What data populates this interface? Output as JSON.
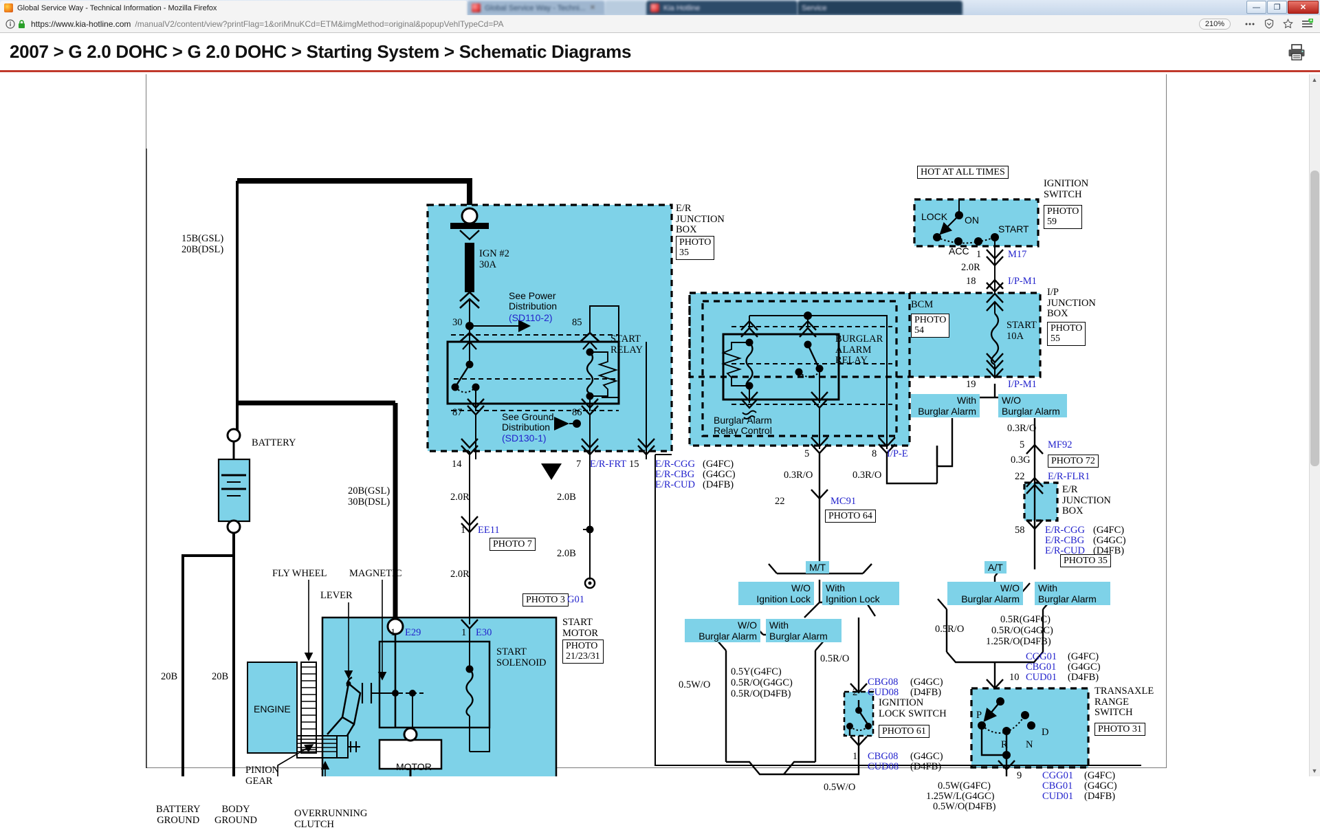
{
  "browser": {
    "window_title": "Global Service Way - Technical Information - Mozilla Firefox",
    "tabs": [
      {
        "label": "Global Service Way - Technical Information - Mozilla Firefox",
        "state": "active"
      },
      {
        "label": "Global Service Way - Techni...",
        "state": "inactive"
      },
      {
        "label": "Kia Hotline",
        "state": "inactive"
      },
      {
        "label": "Service",
        "state": "inactive"
      }
    ],
    "window_controls": {
      "minimize": "—",
      "maximize": "❐",
      "close": "✕"
    },
    "url": {
      "scheme_host": "https://www.kia-hotline.com",
      "path": "/manualV2/content/view?printFlag=1&oriMnuKCd=ETM&imgMethod=original&popupVehlTypeCd=PA",
      "full": "https://www.kia-hotline.com/manualV2/content/view?printFlag=1&oriMnuKCd=ETM&imgMethod=original&popupVehlTypeCd=PA"
    },
    "zoom_level": "210%",
    "toolbar_icons": [
      "info-icon",
      "lock-icon",
      "page-actions-icon",
      "tracking-shield-icon",
      "bookmark-star-icon",
      "hamburger-menu-icon"
    ]
  },
  "page": {
    "title": "2007 > G 2.0 DOHC > G 2.0 DOHC > Starting System > Schematic Diagrams",
    "print_icon": "printer-icon"
  },
  "diagram": {
    "title": "Starting System Schematic Diagram",
    "accent_cyan": "#7ed2e8",
    "accent_blue_text": "#2222cc",
    "labels": {
      "hot_at_all_times": "HOT AT ALL TIMES",
      "ignition_switch": "IGNITION\nSWITCH",
      "photo_59": "PHOTO\n59",
      "ign_pos_lock": "LOCK",
      "ign_pos_acc": "ACC",
      "ign_pos_on": "ON",
      "ign_pos_start": "START",
      "m17": "M17",
      "w_2_0r_a": "2.0R",
      "pin_1_m17": "1",
      "pin_18": "18",
      "ip_m1_top": "I/P-M1",
      "ip_junction_box": "I/P\nJUNCTION\nBOX",
      "photo_55": "PHOTO\n55",
      "start_10a": "START\n10A",
      "pin_19": "19",
      "ip_m1_bottom": "I/P-M1",
      "with_burglar_alarm_1": "With\nBurglar Alarm",
      "wo_burglar_alarm_1": "W/O\nBurglar Alarm",
      "w_0_3ro_a": "0.3R/O",
      "pin_5_mf92": "5",
      "mf92": "MF92",
      "photo_72": "PHOTO 72",
      "w_0_3g": "0.3G",
      "pin_22_flr1": "22",
      "er_flr1": "E/R-FLR1",
      "er_junction_box_right": "E/R\nJUNCTION\nBOX",
      "pin_58": "58",
      "er_cgg_58": "E/R-CGG",
      "er_cbg_58": "E/R-CBG",
      "er_cud_58": "E/R-CUD",
      "g4fc": "(G4FC)",
      "g4gc": "(G4GC)",
      "d4fb": "(D4FB)",
      "photo_35_right": "PHOTO 35",
      "bcm": "BCM",
      "photo_54": "PHOTO\n54",
      "burglar_alarm_relay": "BURGLAR\nALARM\nRELAY",
      "burglar_alarm_relay_control": "Burglar Alarm\nRelay Control",
      "pin_5_ipe": "5",
      "pin_8_ipe": "8",
      "ip_e": "I/P-E",
      "w_0_3ro_b": "0.3R/O",
      "w_0_3ro_c": "0.3R/O",
      "pin_22_mc91": "22",
      "mc91": "MC91",
      "photo_64": "PHOTO 64",
      "mt": "M/T",
      "at": "A/T",
      "wo_ignition_lock": "W/O\nIgnition Lock",
      "with_ignition_lock": "With\nIgnition Lock",
      "wo_burglar_alarm_2": "W/O\nBurglar Alarm",
      "with_burglar_alarm_2": "With\nBurglar Alarm",
      "wo_burglar_alarm_3": "W/O\nBurglar Alarm",
      "with_burglar_alarm_3": "With\nBurglar Alarm",
      "w_0_5wo_a": "0.5W/O",
      "w_0_5y_g4fc": "0.5Y(G4FC)",
      "w_0_5ro_g4gc": "0.5R/O(G4GC)",
      "w_0_5ro_d4fb": "0.5R/O(D4FB)",
      "w_0_5ro_b": "0.5R/O",
      "cbg08": "CBG08",
      "cud08": "CUD08",
      "pin_2": "2",
      "ignition_lock_switch": "IGNITION\nLOCK SWITCH",
      "photo_61": "PHOTO 61",
      "pin_1_lock": "1",
      "cbg08_b": "CBG08",
      "cud08_b": "CUD08",
      "w_0_5wo_b": "0.5W/O",
      "w_0_5ro_c": "0.5R/O",
      "w_0_5r_g4fc": "0.5R(G4FC)",
      "w_0_5ro_g4gc_b": "0.5R/O(G4GC)",
      "w_1_25ro_d4fb": "1.25R/O(D4FB)",
      "cgg01": "CGG01",
      "cbg01": "CBG01",
      "cud01": "CUD01",
      "pin_10": "10",
      "transaxle_range_switch": "TRANSAXLE\nRANGE\nSWITCH",
      "photo_31": "PHOTO 31",
      "trs_p": "P",
      "trs_r": "R",
      "trs_n": "N",
      "trs_d": "D",
      "pin_9": "9",
      "cgg01_b": "CGG01",
      "cbg01_b": "CBG01",
      "cud01_b": "CUD01",
      "w_0_5w_g4fc": "0.5W(G4FC)",
      "w_1_25wl_g4gc": "1.25W/L(G4GC)",
      "w_0_5wo_d4fb": "0.5W/O(D4FB)",
      "er_junction_box_left": "E/R\nJUNCTION\nBOX",
      "photo_35_left": "PHOTO\n35",
      "ign_2_30a": "IGN #2\n30A",
      "see_power_distribution": "See Power\nDistribution",
      "sd110_2": "(SD110-2)",
      "see_ground_distribution": "See Ground\nDistribution",
      "sd130_1": "(SD130-1)",
      "pin_30": "30",
      "pin_85": "85",
      "pin_87": "87",
      "pin_86": "86",
      "start_relay": "START\nRELAY",
      "pin_14": "14",
      "pin_7": "7",
      "er_frt": "E/R-FRT",
      "pin_15": "15",
      "er_cgg_15": "E/R-CGG",
      "er_cbg_15": "E/R-CBG",
      "er_cud_15": "E/R-CUD",
      "w_2_0r_b": "2.0R",
      "w_2_0b_a": "2.0B",
      "w_2_0b_b": "2.0B",
      "w_2_0r_c": "2.0R",
      "pin_1_ee11": "1",
      "ee11": "EE11",
      "photo_7": "PHOTO 7",
      "photo_3": "PHOTO 3",
      "g01": "G01",
      "w_15b_gsl": "15B(GSL)",
      "w_20b_dsl": "20B(DSL)",
      "w_20b_gsl": "20B(GSL)",
      "w_30b_dsl": "30B(DSL)",
      "battery": "BATTERY",
      "w_20b_left": "20B",
      "w_20b_right": "20B",
      "battery_ground": "BATTERY\nGROUND",
      "body_ground": "BODY\nGROUND",
      "engine": "ENGINE",
      "pinion_gear": "PINION\nGEAR",
      "overrunning_clutch": "OVERRUNNING\nCLUTCH",
      "fly_wheel": "FLY WHEEL",
      "magnetic": "MAGNETIC",
      "lever": "LEVER",
      "motor": "MOTOR",
      "start_motor": "START\nMOTOR",
      "photo_21_23_31": "PHOTO\n21/23/31",
      "start_solenoid": "START\nSOLENOID",
      "pin_1_e29": "1",
      "e29": "E29",
      "pin_1_e30": "1",
      "e30": "E30"
    }
  }
}
